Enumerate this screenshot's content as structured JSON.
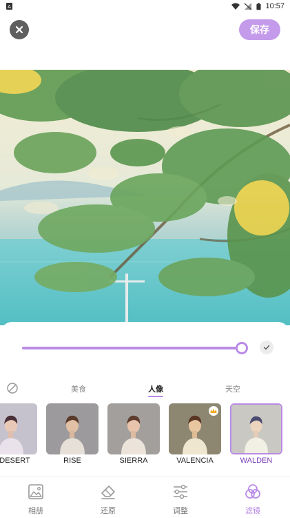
{
  "status_bar": {
    "time": "10:57",
    "icons": [
      "notification-icon",
      "wifi-icon",
      "no-signal-icon",
      "battery-icon"
    ]
  },
  "header": {
    "close_icon": "close-icon",
    "save_label": "保存"
  },
  "adjust": {
    "intensity_percent": 100,
    "confirm_icon": "check-icon"
  },
  "categories": {
    "none_icon": "no-filter-icon",
    "items": [
      {
        "label": "美食",
        "active": false
      },
      {
        "label": "人像",
        "active": true
      },
      {
        "label": "天空",
        "active": false
      }
    ]
  },
  "filters": [
    {
      "label": "D DESERT",
      "selected": false,
      "premium": false
    },
    {
      "label": "RISE",
      "selected": false,
      "premium": false
    },
    {
      "label": "SIERRA",
      "selected": false,
      "premium": false
    },
    {
      "label": "VALENCIA",
      "selected": false,
      "premium": true
    },
    {
      "label": "WALDEN",
      "selected": true,
      "premium": false
    }
  ],
  "bottom_nav": [
    {
      "label": "相册",
      "icon": "gallery-icon",
      "active": false
    },
    {
      "label": "还原",
      "icon": "eraser-icon",
      "active": false
    },
    {
      "label": "调整",
      "icon": "sliders-icon",
      "active": false
    },
    {
      "label": "滤镜",
      "icon": "filter-icon",
      "active": true
    }
  ],
  "colors": {
    "accent": "#b98be6",
    "save_button": "#c49bea",
    "selected_label": "#7a3fb8"
  }
}
